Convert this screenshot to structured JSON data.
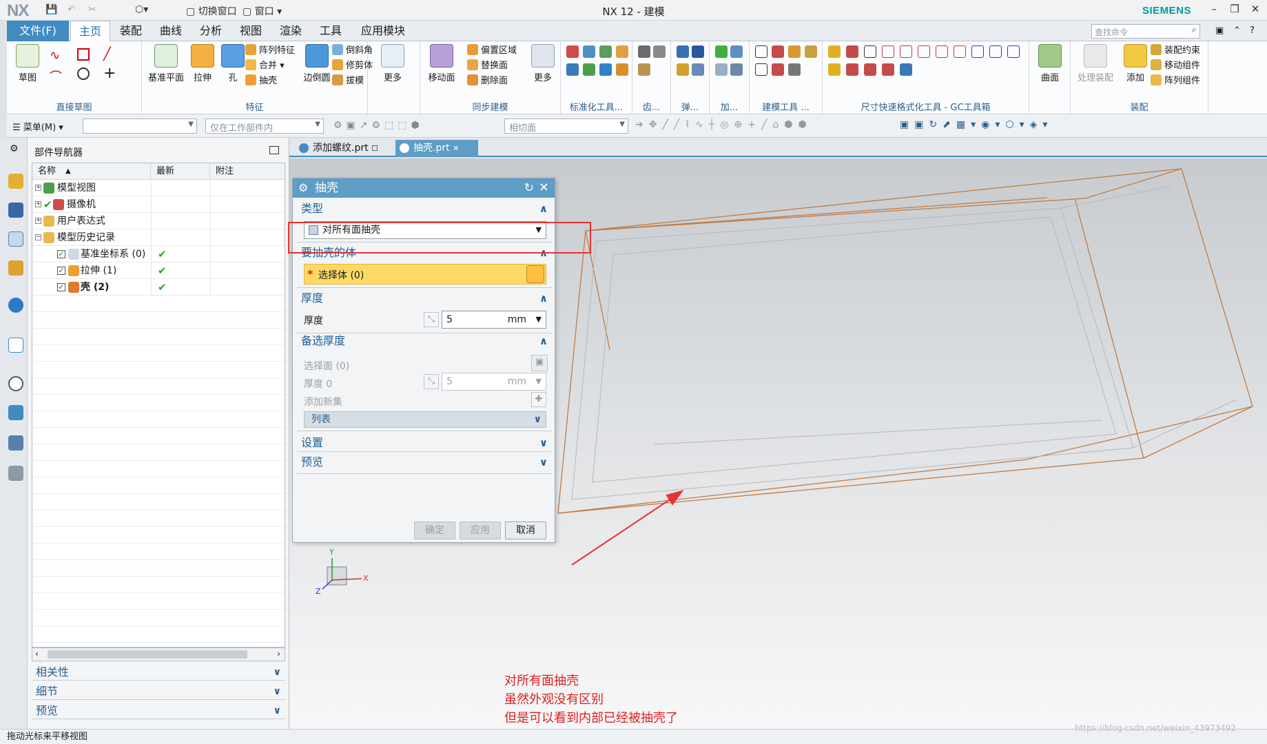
{
  "app": {
    "logo": "NX",
    "title": "NX 12 - 建模",
    "brand": "SIEMENS",
    "quick_access": {
      "switch_window": "切换窗口",
      "window": "窗口"
    }
  },
  "menu_tabs": [
    "文件(F)",
    "主页",
    "装配",
    "曲线",
    "分析",
    "视图",
    "渲染",
    "工具",
    "应用模块"
  ],
  "search": {
    "placeholder": "查找命令"
  },
  "ribbon": {
    "direct_sketch": {
      "sketch": "草图",
      "label": "直接草图"
    },
    "feature": {
      "datum_plane": "基准平面",
      "extrude": "拉伸",
      "hole": "孔",
      "pattern_feature": "阵列特征",
      "unite": "合并",
      "shell": "抽壳",
      "edge_blend": "边倒圆",
      "chamfer": "倒斜角",
      "trim_body": "修剪体",
      "draft": "拔模",
      "more": "更多",
      "label": "特征"
    },
    "sync": {
      "move_face": "移动面",
      "offset_region": "偏置区域",
      "replace_face": "替换面",
      "delete_face": "删除面",
      "more": "更多",
      "label": "同步建模"
    },
    "std_tools_label": "标准化工具...",
    "gear_label": "齿...",
    "spring_label": "弹...",
    "add_label": "加...",
    "modeling_tools_label": "建模工具 ...",
    "dim_tools_label": "尺寸快速格式化工具 - GC工具箱",
    "surface": {
      "label": "曲面"
    },
    "assembly": {
      "process_assembly": "处理装配",
      "add": "添加",
      "assembly_constraint": "装配约束",
      "move_component": "移动组件",
      "pattern_component": "阵列组件",
      "label": "装配"
    }
  },
  "toolbar2": {
    "menu": "菜单(M)",
    "filter_placeholder": "仅在工作部件内",
    "snap_placeholder": "相切面"
  },
  "navigator": {
    "title": "部件导航器",
    "columns": [
      "名称",
      "最新",
      "附注"
    ],
    "rows": [
      {
        "name": "模型视图",
        "latest": ""
      },
      {
        "name": "摄像机",
        "latest": ""
      },
      {
        "name": "用户表达式",
        "latest": ""
      },
      {
        "name": "模型历史记录",
        "latest": ""
      },
      {
        "name": "基准坐标系 (0)",
        "latest": "✔"
      },
      {
        "name": "拉伸 (1)",
        "latest": "✔"
      },
      {
        "name": "壳 (2)",
        "latest": "✔"
      }
    ],
    "sections": [
      "相关性",
      "细节",
      "预览"
    ]
  },
  "doc_tabs": [
    "添加螺纹.prt",
    "抽壳.prt"
  ],
  "dialog": {
    "title": "抽壳",
    "type_section": "类型",
    "type_value": "对所有面抽壳",
    "body_section": "要抽壳的体",
    "select_body": "选择体 (0)",
    "thickness_section": "厚度",
    "thickness_label": "厚度",
    "thickness_value": "5",
    "unit": "mm",
    "alt_thickness_section": "备选厚度",
    "select_face": "选择面 (0)",
    "thickness0_label": "厚度 0",
    "thickness0_value": "5",
    "add_new_set": "添加新集",
    "list": "列表",
    "settings_section": "设置",
    "preview_section": "预览",
    "ok": "确定",
    "apply": "应用",
    "cancel": "取消"
  },
  "annotation": [
    "对所有面抽壳",
    "虽然外观没有区别",
    "但是可以看到内部已经被抽壳了"
  ],
  "triad": {
    "x": "X",
    "y": "Y",
    "z": "Z"
  },
  "status": "拖动光标来平移视图",
  "watermark": "https://blog.csdn.net/weixin_43973492",
  "colors": {
    "accent": "#3f8bc2",
    "annotation": "#e02020",
    "selection": "#ffd966",
    "wireframe": "#c27a42"
  }
}
